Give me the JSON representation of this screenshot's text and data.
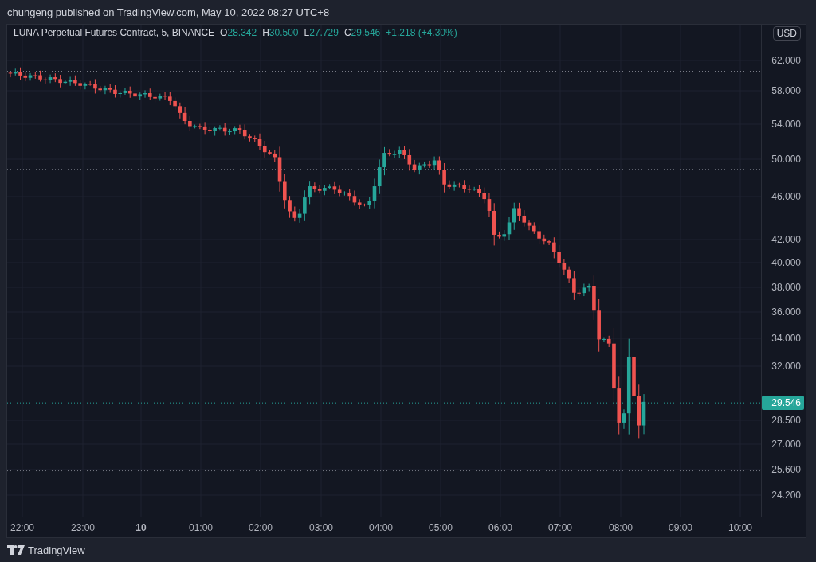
{
  "attribution": "chungeng published on TradingView.com, May 10, 2022 08:27 UTC+8",
  "legend": {
    "symbol": "LUNA Perpetual Futures Contract, 5, BINANCE",
    "values": [
      {
        "label": "O",
        "value": "28.342"
      },
      {
        "label": "H",
        "value": "30.500"
      },
      {
        "label": "L",
        "value": "27.729"
      },
      {
        "label": "C",
        "value": "29.546"
      }
    ],
    "change": "+1.218 (+4.30%)"
  },
  "currency": "USD",
  "price_axis": [
    "62.000",
    "58.000",
    "54.000",
    "50.000",
    "46.000",
    "42.000",
    "40.000",
    "38.000",
    "36.000",
    "34.000",
    "32.000",
    "28.500",
    "27.000",
    "25.600",
    "24.200"
  ],
  "last_price": "29.546",
  "time_axis": [
    {
      "label": "22:00",
      "kind": "time"
    },
    {
      "label": "23:00",
      "kind": "time"
    },
    {
      "label": "10",
      "kind": "day"
    },
    {
      "label": "01:00",
      "kind": "time"
    },
    {
      "label": "02:00",
      "kind": "time"
    },
    {
      "label": "03:00",
      "kind": "time"
    },
    {
      "label": "04:00",
      "kind": "time"
    },
    {
      "label": "05:00",
      "kind": "time"
    },
    {
      "label": "06:00",
      "kind": "time"
    },
    {
      "label": "07:00",
      "kind": "time"
    },
    {
      "label": "08:00",
      "kind": "time"
    },
    {
      "label": "09:00",
      "kind": "time"
    },
    {
      "label": "10:00",
      "kind": "time"
    }
  ],
  "footer": {
    "brand": "TradingView"
  }
}
